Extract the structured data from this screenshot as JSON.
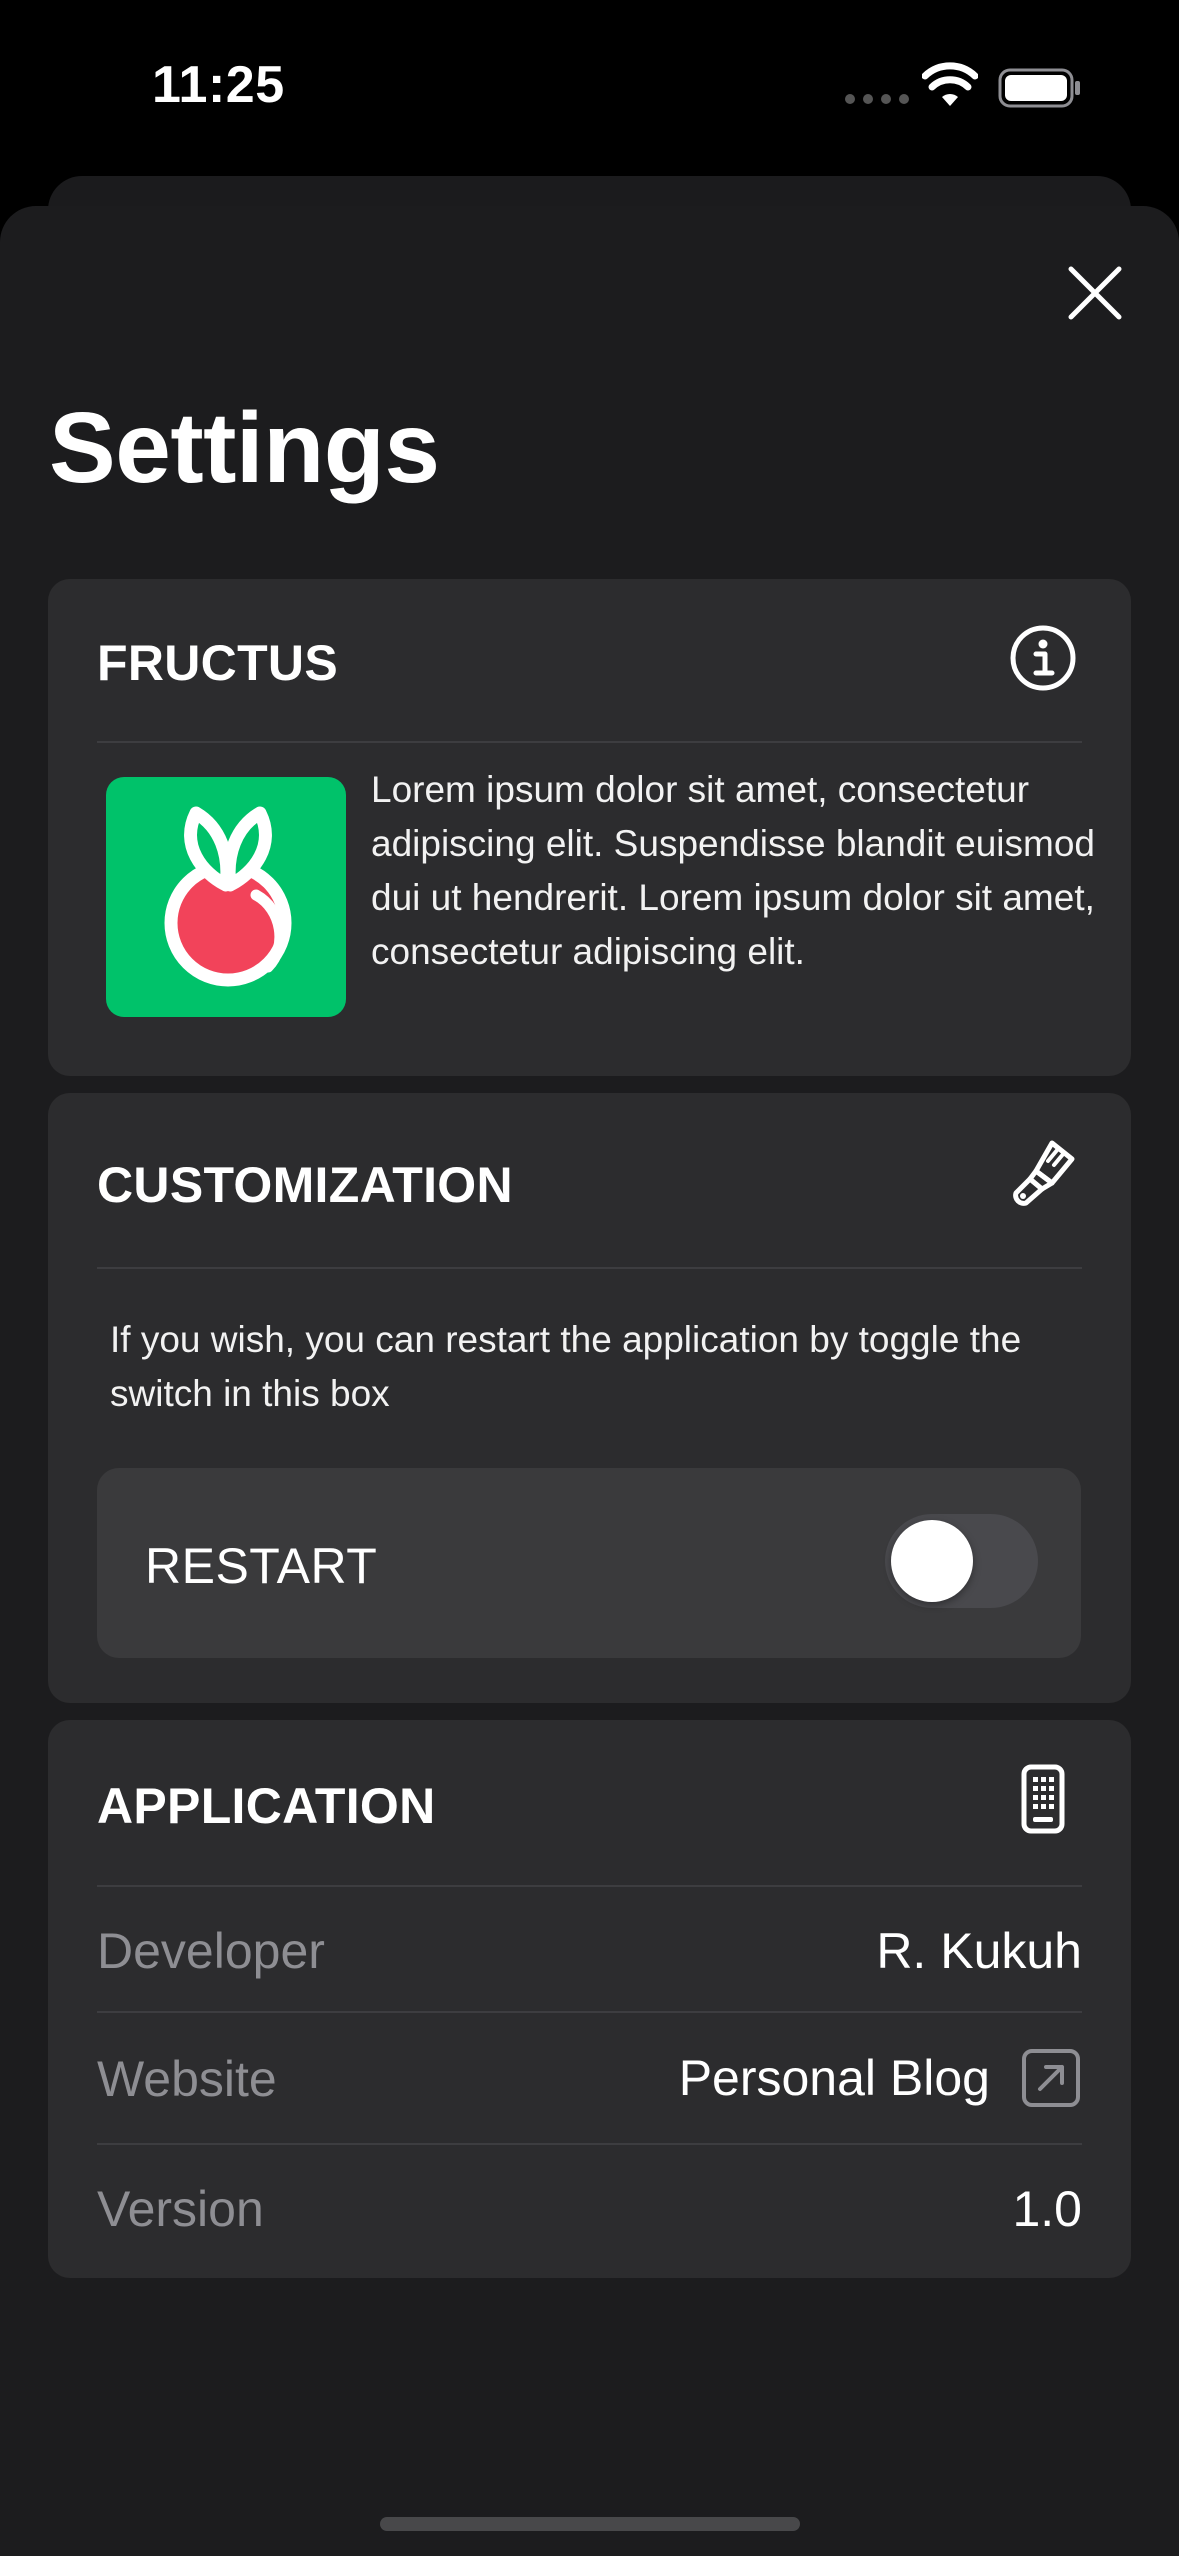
{
  "status_bar": {
    "time": "11:25"
  },
  "sheet": {
    "title": "Settings"
  },
  "fructus": {
    "title": "FRUCTUS",
    "icon": "info-circle-icon",
    "description": "Lorem ipsum dolor sit amet, consectetur adipiscing elit. Suspendisse blandit euismod dui ut hendrerit. Lorem ipsum dolor sit amet, consectetur adipiscing elit."
  },
  "customization": {
    "title": "CUSTOMIZATION",
    "icon": "paintbrush-icon",
    "description": "If you wish, you can restart the application by toggle the switch in this box",
    "restart_label": "RESTART",
    "restart_on": false
  },
  "application": {
    "title": "APPLICATION",
    "icon": "iphone-icon",
    "rows": [
      {
        "label": "Developer",
        "value": "R. Kukuh"
      },
      {
        "label": "Website",
        "value": "Personal Blog"
      },
      {
        "label": "Version",
        "value": "1.0"
      }
    ]
  },
  "colors": {
    "background": "#000000",
    "sheet": "#1c1c1e",
    "card": "#2c2c2e",
    "logo_green": "#00c26a",
    "fruit_red": "#f2435a",
    "secondary_text": "#8e8e93"
  }
}
